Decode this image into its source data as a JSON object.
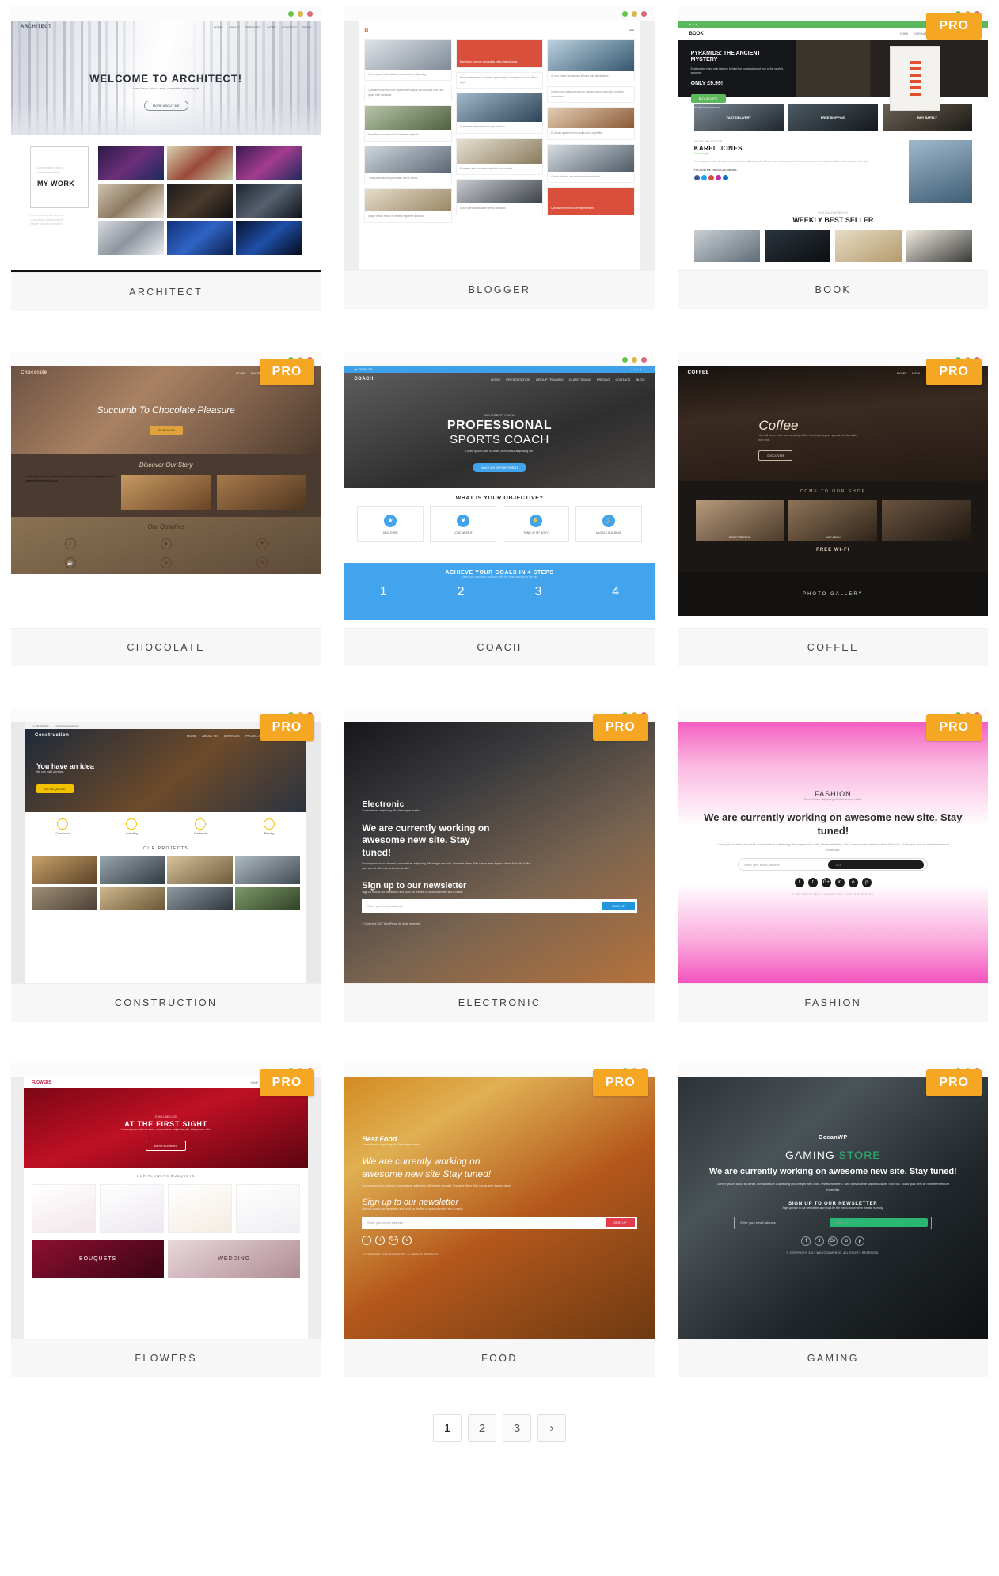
{
  "gallery": {
    "cards": [
      {
        "label": "ARCHITECT",
        "pro": false,
        "brand": "ARCHITECT",
        "hero_title": "WELCOME TO ARCHITECT!",
        "sub_title": "Lorem ipsum dolor sit amet, consectetur adipiscing elit.",
        "cta": "MORE ABOUT ME",
        "section_title": "MY WORK",
        "nav": [
          "HOME",
          "ABOUT",
          "SERVICES",
          "WORK",
          "CONTACT",
          "BLOG"
        ]
      },
      {
        "label": "BLOGGER",
        "pro": false,
        "brand": "B",
        "hero_title": "",
        "sub_title": "",
        "cta": "",
        "section_title": "",
        "nav": []
      },
      {
        "label": "BOOK",
        "pro": true,
        "brand": "BOOK",
        "hero_title": "PYRAMIDS: THE ANCIENT MYSTERY",
        "sub_title": "Exciting story and real science behind the construction of one of the world's wonders.",
        "price": "ONLY £9.99!",
        "cta": "BUY A COPY",
        "cta_note": "Free with first purchase",
        "topbar_note": "Sign in / Register",
        "author_kicker": "ABOUT THE AUTHOR",
        "author_name": "KAREL JONES",
        "author_role": "Archeologist",
        "follow_label": "FOLLOW ME ON SOCIAL MEDIA",
        "best_kicker": "OUR AMAZING BOOKS",
        "best_title": "WEEKLY BEST SELLER",
        "tiles": [
          "FAST DELIVERY",
          "FREE SHIPPING",
          "BUY SAFELY"
        ],
        "nav": [
          "HOME",
          "OUR AUTHORS",
          "SHOP",
          "CONTACT"
        ]
      },
      {
        "label": "CHOCOLATE",
        "pro": true,
        "brand": "Chocolate",
        "hero_title": "Succumb To Chocolate Pleasure",
        "cta": "SHOP NOW",
        "section_title": "Discover Our Story",
        "section_title2": "Our Qualities",
        "nav": [
          "HOME",
          "SHOP",
          "ABOUT",
          "BLOG",
          "CONTACT"
        ]
      },
      {
        "label": "COACH",
        "pro": false,
        "brand": "COACH",
        "hero_kicker": "WELCOME TO COACH",
        "hero_title": "PROFESSIONAL",
        "hero_title2": "SPORTS COACH",
        "sub_title": "Lorem ipsum dolor sit amet, consectetur adipiscing elit.",
        "cta": "MAKE AN APPOINTMENT",
        "objective_title": "WHAT IS YOUR OBJECTIVE?",
        "objectives": [
          "HEALTHIER",
          "LOSE WEIGHT",
          "TONE UP MY BODY",
          "MUSCLE BUILDING"
        ],
        "steps_title": "ACHIEVE YOUR GOALS IN 4 STEPS",
        "steps_sub": "Make your own plan and train with the best coaches in the city",
        "steps": [
          "1",
          "2",
          "3",
          "4"
        ],
        "nav": [
          "HOME",
          "PRESENTATION",
          "GROUP TRAINING",
          "CLASS TIMING",
          "PRICING",
          "CONTACT",
          "BLOG"
        ]
      },
      {
        "label": "COFFEE",
        "pro": true,
        "brand": "COFFEE",
        "hero_title": "Coffee",
        "sub_title": "You will never know how amazing coffee is until you try our special blends made with love.",
        "cta": "DISCOVER",
        "section_kicker": "COME TO OUR SHOP",
        "free_wifi": "FREE WI-FI",
        "gallery_title": "PHOTO GALLERY",
        "tiles": [
          "COMFY SEATING",
          "OUR MENU"
        ],
        "nav": [
          "HOME",
          "MENU",
          "ABOUT",
          "GALLERY",
          "CONTACT"
        ]
      },
      {
        "label": "CONSTRUCTION",
        "pro": true,
        "brand": "Construction",
        "phone": "+1 700-000-000",
        "email": "contact@example.com",
        "hero_title": "You have an idea",
        "hero_title2": "We can build anything",
        "cta": "GET A QUOTE",
        "features": [
          "Construction",
          "Consulting",
          "Architecture",
          "Planning"
        ],
        "section_title": "OUR PROJECTS",
        "nav": [
          "HOME",
          "ABOUT US",
          "SERVICES",
          "PROJECTS",
          "BLOG",
          "CONTACT"
        ]
      },
      {
        "label": "ELECTRONIC",
        "pro": true,
        "brand": "Electronic",
        "brand_sub": "Consectetuer adipiscing elit ullamcorper mattis.",
        "hero_title": "We are currently working on awesome new site. Stay tuned!",
        "sub_title": "Lorem ipsum dolor sit amet, consectetuer adipiscing elit, integer nec odio. Praesent libero. Sed cursus ante dapibus diam. Sed nisi. Nulla quis sem at nibh elementum imperdiet.",
        "newsletter_title": "Sign up to our newsletter",
        "newsletter_sub": "Sign up now to our newsletter and you'll be the first to know when the site is ready.",
        "email_placeholder": "Enter your email address",
        "email_button": "SIGN UP",
        "copyright": "© Copyright 2017 WordPress. All rights reserved."
      },
      {
        "label": "FASHION",
        "pro": true,
        "brand": "FASHION",
        "brand_sub": "Consectetuer adipiscing elit ullamcorper mattis.",
        "hero_title": "We are currently working on awesome new site. Stay tuned!",
        "sub_title": "Lorem ipsum dolor sit amet, consectetuer adipiscing elit, integer nec odio. Praesent libero. Sed cursus ante dapibus diam. Sed nisi. Nulla quis sem at nibh elementum imperdiet.",
        "email_placeholder": "Enter your email address",
        "email_button": "GO",
        "copyright": "© COPYRIGHT 2017 OCEANWP. ALL RIGHTS RESERVED.",
        "socials": [
          "f",
          "t",
          "G+",
          "in",
          "o",
          "p"
        ]
      },
      {
        "label": "FLOWERS",
        "pro": true,
        "brand": "FLOWERS",
        "hero_kicker": "IT WILL BE LOVE",
        "hero_title": "AT THE FIRST SIGHT",
        "sub_title": "Lorem ipsum dolor sit amet, consectetuer adipiscing elit, integer nec odio.",
        "cta": "BUY FLOWERS",
        "section_title": "OUR FLOWERS BOUQUETS",
        "tiles": [
          "BOUQUETS",
          "WEDDING"
        ],
        "nav": [
          "HOME",
          "SHOP",
          "ABOUT",
          "CONTACT"
        ]
      },
      {
        "label": "FOOD",
        "pro": true,
        "brand": "Best Food",
        "brand_sub": "Consectetuer adipiscing elit ullamcorper mattis.",
        "hero_title": "We are currently working on awesome new site Stay tuned!",
        "sub_title": "Lorem ipsum dolor sit amet, consectetuer adipiscing elit, integer nec odio. Praesent libero. Sed cursus ante dapibus diam.",
        "newsletter_title": "Sign up to our newsletter",
        "newsletter_sub": "Sign up now to our newsletter and you'll be the first to know when the site is ready.",
        "email_placeholder": "Enter your email address",
        "email_button": "SIGN UP",
        "copyright": "© COPYRIGHT 2017 WORDPRESS. ALL RIGHTS RESERVED.",
        "socials": [
          "f",
          "t",
          "G+",
          "o"
        ]
      },
      {
        "label": "GAMING",
        "pro": true,
        "brand": "OceanWP",
        "hero_title": "GAMING",
        "hero_title_accent": "STORE",
        "tagline": "We are currently working on awesome new site. Stay tuned!",
        "sub_title": "Lorem ipsum dolor sit amet, consectetuer adipiscing elit, integer nec odio. Praesent libero. Sed cursus ante dapibus diam. Sed nisi. Nulla quis sem at nibh elementum imperdiet.",
        "newsletter_title": "SIGN UP TO OUR NEWSLETTER",
        "newsletter_sub": "Sign up now to our newsletter and you'll be the first to know when the site is ready.",
        "email_placeholder": "Enter your email address",
        "email_button": "SIGN UP",
        "copyright": "© COPYRIGHT 2017 WOOCOMMERCE. ALL RIGHTS RESERVED.",
        "socials": [
          "f",
          "t",
          "G+",
          "o",
          "p"
        ]
      }
    ],
    "pro_badge_label": "PRO"
  },
  "pagination": {
    "pages": [
      "1",
      "2",
      "3"
    ],
    "next_label": "›",
    "current": "1"
  },
  "colors": {
    "pro_badge": "#f5a623",
    "dot_green": "#6cc24a",
    "dot_yellow": "#d9b54a",
    "dot_red": "#d9697a",
    "label_bg": "#f7f7f7",
    "coach_blue": "#41a4ec",
    "book_green": "#5cb85c",
    "gaming_green": "#2bb673"
  }
}
